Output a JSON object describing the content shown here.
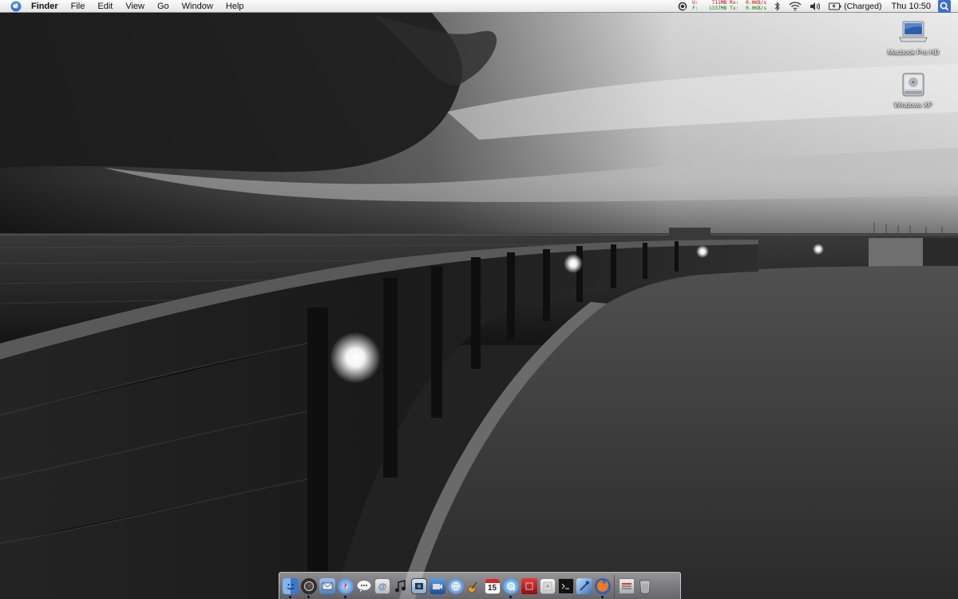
{
  "menubar": {
    "app_name": "Finder",
    "menus": [
      "File",
      "Edit",
      "View",
      "Go",
      "Window",
      "Help"
    ],
    "net": {
      "u_key": "U:",
      "u_val": "711MB",
      "rx_label": "Rx:",
      "rx_val": "0.0KB/s",
      "f_key": "F:",
      "f_val": "1337MB",
      "tx_label": "Tx:",
      "tx_val": "0.0KB/s"
    },
    "battery_status": "(Charged)",
    "clock": "Thu 10:50"
  },
  "desktop": {
    "icons": [
      {
        "label": "Macbook Pro HD",
        "icon": "laptop-icon"
      },
      {
        "label": "Windows XP",
        "icon": "hard-drive-icon"
      }
    ]
  },
  "dock": {
    "apps": [
      {
        "icon": "finder-icon",
        "running": true
      },
      {
        "icon": "dashboard-icon",
        "running": true
      },
      {
        "icon": "mail-icon",
        "running": false
      },
      {
        "icon": "safari-icon",
        "running": true
      },
      {
        "icon": "ichat-icon",
        "running": false
      },
      {
        "icon": "address-book-icon",
        "running": false
      },
      {
        "icon": "itunes-icon",
        "running": false
      },
      {
        "icon": "iphoto-icon",
        "running": false
      },
      {
        "icon": "imovie-icon",
        "running": false
      },
      {
        "icon": "iweb-icon",
        "running": false
      },
      {
        "icon": "garageband-icon",
        "running": false
      },
      {
        "icon": "ical-icon",
        "running": false
      },
      {
        "icon": "quicktime-icon",
        "running": true
      },
      {
        "icon": "photobooth-icon",
        "running": false
      },
      {
        "icon": "preview-icon",
        "running": false
      },
      {
        "icon": "terminal-icon",
        "running": false
      },
      {
        "icon": "xcode-icon",
        "running": false
      },
      {
        "icon": "firefox-icon",
        "running": true
      }
    ],
    "right": [
      {
        "icon": "system-preferences-icon"
      },
      {
        "icon": "trash-icon"
      }
    ],
    "ical_day": "15"
  },
  "colors": {
    "menubar_top": "#fbfbfb",
    "menubar_bottom": "#e4e4e4",
    "net_upload": "#c00000",
    "net_download": "#008000"
  }
}
